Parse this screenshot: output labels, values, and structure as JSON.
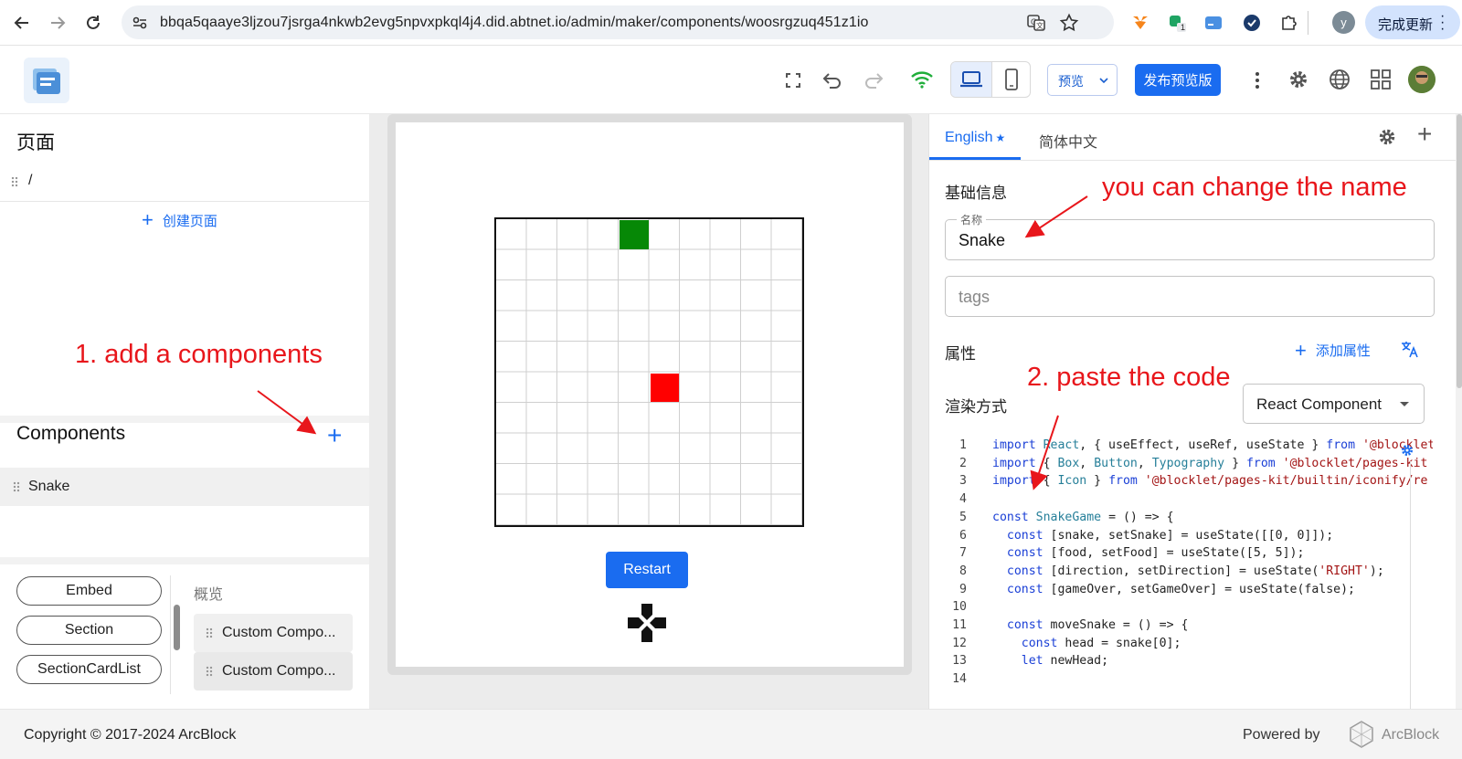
{
  "browser": {
    "url": "bbqa5qaaye3ljzou7jsrga4nkwb2evg5npvxpkql4j4.did.abtnet.io/admin/maker/components/woosrgzuq451z1io",
    "profile_initial": "y",
    "update_label": "完成更新",
    "extension_badge": "1"
  },
  "header": {
    "preview_label": "预览",
    "publish_label": "发布预览版"
  },
  "left": {
    "pages_title": "页面",
    "page_root": "/",
    "create_page_label": "创建页面",
    "components_title": "Components",
    "components": [
      "Snake"
    ],
    "palette": [
      "Embed",
      "Section",
      "SectionCardList"
    ],
    "overview_label": "概览",
    "custom_items": [
      "Custom Compo...",
      "Custom Compo..."
    ]
  },
  "canvas": {
    "restart_label": "Restart",
    "grid_size": 10,
    "snake_cell": [
      4,
      0
    ],
    "food_cell": [
      5,
      5
    ]
  },
  "right": {
    "tabs": [
      "English",
      "简体中文"
    ],
    "tab_marker": "★",
    "basic_info_title": "基础信息",
    "name_label": "名称",
    "name_value": "Snake",
    "tags_placeholder": "tags",
    "props_title": "属性",
    "add_prop_label": "添加属性",
    "render_mode_label": "渲染方式",
    "render_mode_value": "React Component",
    "code_lines": [
      "import React, { useEffect, useRef, useState } from '@blocklet",
      "import { Box, Button, Typography } from '@blocklet/pages-kit",
      "import { Icon } from '@blocklet/pages-kit/builtin/iconify/re",
      "",
      "const SnakeGame = () => {",
      "  const [snake, setSnake] = useState([[0, 0]]);",
      "  const [food, setFood] = useState([5, 5]);",
      "  const [direction, setDirection] = useState('RIGHT');",
      "  const [gameOver, setGameOver] = useState(false);",
      "",
      "  const moveSnake = () => {",
      "    const head = snake[0];",
      "    let newHead;",
      ""
    ]
  },
  "footer": {
    "copyright": "Copyright © 2017-2024  ArcBlock",
    "powered_by": "Powered by",
    "brand": "ArcBlock"
  },
  "annotations": {
    "step1": "1. add a components",
    "step2": "2. paste the code",
    "name_hint": "you can change the name"
  },
  "colors": {
    "primary": "#1a6cf0",
    "annotation": "#e8161b",
    "snake": "#068806",
    "food": "#ff0000",
    "wifi": "#1fae3a"
  }
}
